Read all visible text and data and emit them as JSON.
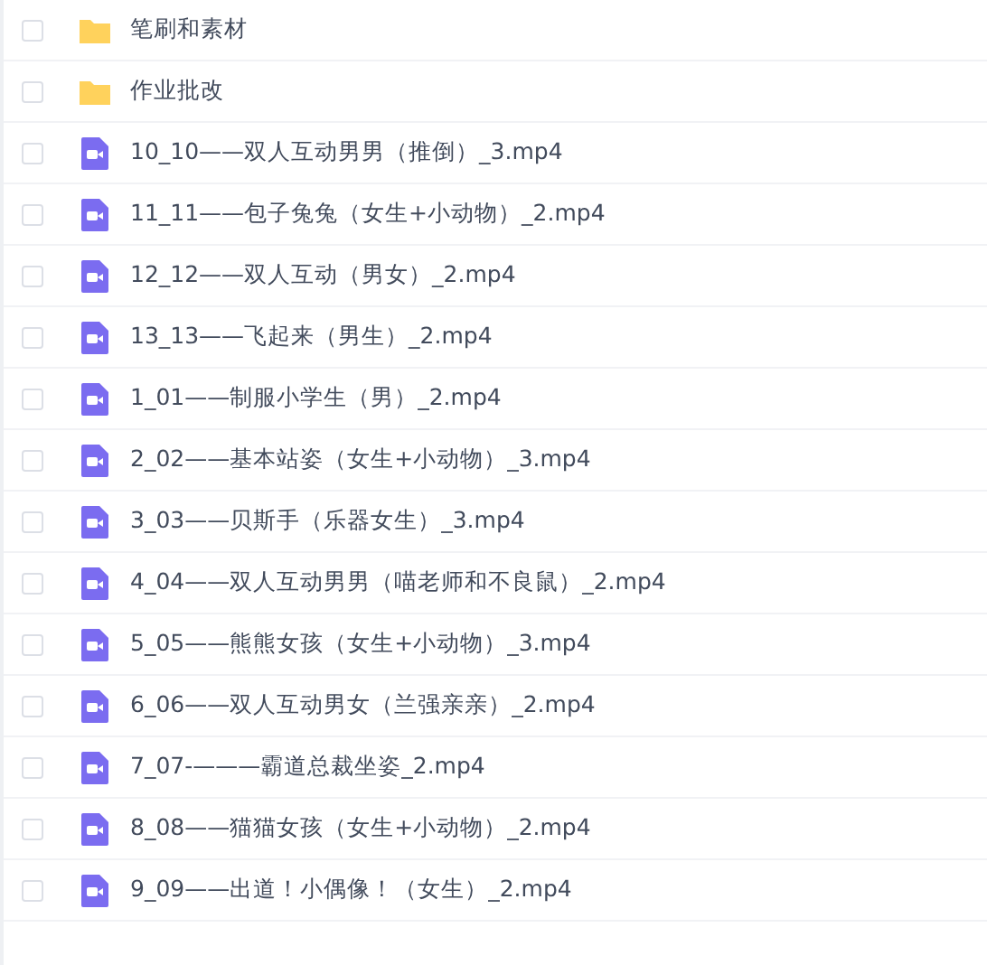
{
  "files": [
    {
      "kind": "folder",
      "name": "笔刷和素材",
      "checked": false
    },
    {
      "kind": "folder",
      "name": "作业批改",
      "checked": false
    },
    {
      "kind": "video",
      "name": "10_10——双人互动男男（推倒）_3.mp4",
      "checked": false
    },
    {
      "kind": "video",
      "name": "11_11——包子兔兔（女生+小动物）_2.mp4",
      "checked": false
    },
    {
      "kind": "video",
      "name": "12_12——双人互动（男女）_2.mp4",
      "checked": false
    },
    {
      "kind": "video",
      "name": "13_13——飞起来（男生）_2.mp4",
      "checked": false
    },
    {
      "kind": "video",
      "name": "1_01——制服小学生（男）_2.mp4",
      "checked": false
    },
    {
      "kind": "video",
      "name": "2_02——基本站姿（女生+小动物）_3.mp4",
      "checked": false
    },
    {
      "kind": "video",
      "name": "3_03——贝斯手（乐器女生）_3.mp4",
      "checked": false
    },
    {
      "kind": "video",
      "name": "4_04——双人互动男男（喵老师和不良鼠）_2.mp4",
      "checked": false
    },
    {
      "kind": "video",
      "name": "5_05——熊熊女孩（女生+小动物）_3.mp4",
      "checked": false
    },
    {
      "kind": "video",
      "name": "6_06——双人互动男女（兰强亲亲）_2.mp4",
      "checked": false
    },
    {
      "kind": "video",
      "name": "7_07-———霸道总裁坐姿_2.mp4",
      "checked": false
    },
    {
      "kind": "video",
      "name": "8_08——猫猫女孩（女生+小动物）_2.mp4",
      "checked": false
    },
    {
      "kind": "video",
      "name": "9_09——出道！小偶像！（女生）_2.mp4",
      "checked": false
    }
  ]
}
